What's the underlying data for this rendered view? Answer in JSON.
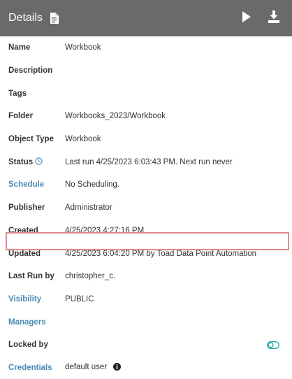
{
  "header": {
    "title": "Details",
    "doc_icon": "document-icon",
    "play_icon": "play-icon",
    "download_icon": "download-icon"
  },
  "fields": [
    {
      "key": "name",
      "label": "Name",
      "value": "Workbook"
    },
    {
      "key": "description",
      "label": "Description",
      "value": ""
    },
    {
      "key": "tags",
      "label": "Tags",
      "value": ""
    },
    {
      "key": "folder",
      "label": "Folder",
      "value": "Workbooks_2023/Workbook"
    },
    {
      "key": "object_type",
      "label": "Object Type",
      "value": "Workbook"
    },
    {
      "key": "status",
      "label": "Status",
      "value": "Last run 4/25/2023 6:03:43 PM. Next run never"
    },
    {
      "key": "schedule",
      "label": "Schedule",
      "value": "No Scheduling."
    },
    {
      "key": "publisher",
      "label": "Publisher",
      "value": "Administrator"
    },
    {
      "key": "created",
      "label": "Created",
      "value": "4/25/2023 4:27:16 PM"
    },
    {
      "key": "updated",
      "label": "Updated",
      "value": "4/25/2023 6:04:20 PM by Toad Data Point Automation"
    },
    {
      "key": "last_run_by",
      "label": "Last Run by",
      "value": "christopher_c."
    },
    {
      "key": "visibility",
      "label": "Visibility",
      "value": "PUBLIC"
    },
    {
      "key": "managers",
      "label": "Managers",
      "value": ""
    },
    {
      "key": "locked_by",
      "label": "Locked by",
      "value": ""
    },
    {
      "key": "credentials",
      "label": "Credentials",
      "value": "default user"
    }
  ],
  "colors": {
    "header_bg": "#6a6a6a",
    "link": "#4a8bb5",
    "highlight": "#e08a8e",
    "toggle": "#2aa8a0"
  }
}
